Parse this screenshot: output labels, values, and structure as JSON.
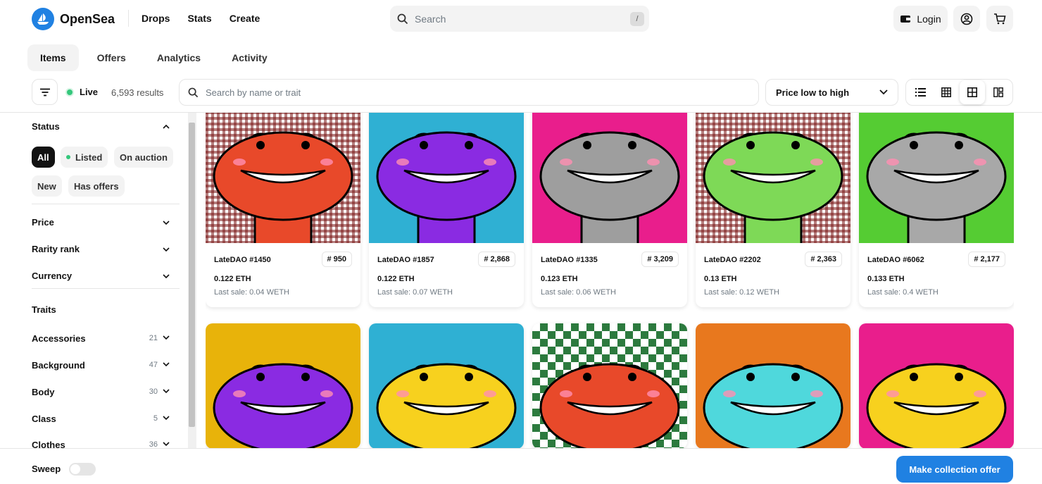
{
  "header": {
    "brand": "OpenSea",
    "nav": [
      "Drops",
      "Stats",
      "Create"
    ],
    "search_placeholder": "Search",
    "search_key": "/",
    "login_label": "Login"
  },
  "tabs": [
    "Items",
    "Offers",
    "Analytics",
    "Activity"
  ],
  "toolbar": {
    "live_label": "Live",
    "results": "6,593 results",
    "search_placeholder": "Search by name or trait",
    "sort_label": "Price low to high"
  },
  "sidebar": {
    "status_title": "Status",
    "status_pills": [
      "All",
      "Listed",
      "On auction",
      "New",
      "Has offers"
    ],
    "price": "Price",
    "rarity": "Rarity rank",
    "currency": "Currency",
    "traits_title": "Traits",
    "traits": [
      {
        "name": "Accessories",
        "count": "21"
      },
      {
        "name": "Background",
        "count": "47"
      },
      {
        "name": "Body",
        "count": "30"
      },
      {
        "name": "Class",
        "count": "5"
      },
      {
        "name": "Clothes",
        "count": "36"
      }
    ]
  },
  "items": [
    {
      "name": "LateDAO #1450",
      "rank": "950",
      "price": "0.122 ETH",
      "last_sale": "Last sale: 0.04 WETH",
      "bg": "checker",
      "body": "#e8492a"
    },
    {
      "name": "LateDAO #1857",
      "rank": "2,868",
      "price": "0.122 ETH",
      "last_sale": "Last sale: 0.07 WETH",
      "bg": "#2fb0d3",
      "body": "#8a2be2"
    },
    {
      "name": "LateDAO #1335",
      "rank": "3,209",
      "price": "0.123 ETH",
      "last_sale": "Last sale: 0.06 WETH",
      "bg": "#e91e8c",
      "body": "#9e9e9e"
    },
    {
      "name": "LateDAO #2202",
      "rank": "2,363",
      "price": "0.13 ETH",
      "last_sale": "Last sale: 0.12 WETH",
      "bg": "checker",
      "body": "#7ed957"
    },
    {
      "name": "LateDAO #6062",
      "rank": "2,177",
      "price": "0.133 ETH",
      "last_sale": "Last sale: 0.4 WETH",
      "bg": "#55cc33",
      "body": "#a8a8a8"
    },
    {
      "bg": "#e8b30a",
      "body": "#8a2be2"
    },
    {
      "bg": "#2fb0d3",
      "body": "#f7d11e"
    },
    {
      "bg": "greencheck",
      "body": "#e8492a"
    },
    {
      "bg": "#e8781e",
      "body": "#4fd8dc"
    },
    {
      "bg": "#e91e8c",
      "body": "#f7d11e"
    }
  ],
  "footer": {
    "sweep_label": "Sweep",
    "cta_label": "Make collection offer"
  },
  "colors": {
    "accent": "#2081e2",
    "live": "#34c77b"
  }
}
